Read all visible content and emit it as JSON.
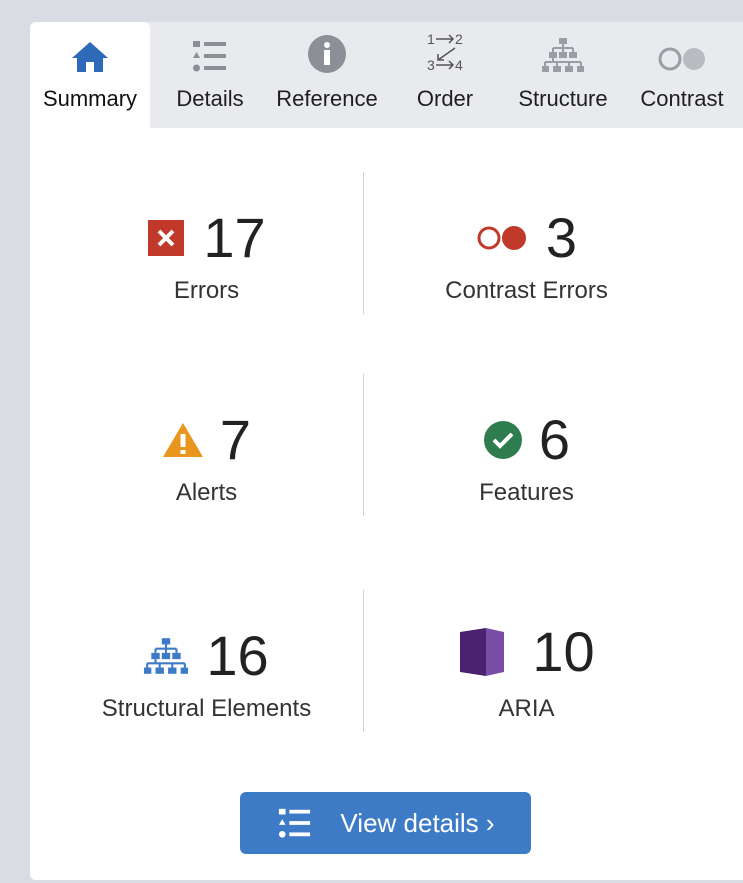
{
  "tabs": [
    {
      "label": "Summary",
      "icon": "home-icon",
      "active": true
    },
    {
      "label": "Details",
      "icon": "list-icon"
    },
    {
      "label": "Reference",
      "icon": "info-icon"
    },
    {
      "label": "Order",
      "icon": "order-icon",
      "icon_text": {
        "a": "1",
        "b": "2",
        "c": "3",
        "d": "4"
      }
    },
    {
      "label": "Structure",
      "icon": "structure-icon"
    },
    {
      "label": "Contrast",
      "icon": "contrast-icon"
    }
  ],
  "stats": {
    "errors": {
      "count": "17",
      "label": "Errors",
      "icon": "error-x-icon",
      "color": "#c0392b"
    },
    "contrast_errors": {
      "count": "3",
      "label": "Contrast Errors",
      "icon": "contrast-error-icon",
      "color": "#c0392b"
    },
    "alerts": {
      "count": "7",
      "label": "Alerts",
      "icon": "alert-triangle-icon",
      "color": "#e8961e"
    },
    "features": {
      "count": "6",
      "label": "Features",
      "icon": "feature-check-icon",
      "color": "#2e7d4f"
    },
    "structural": {
      "count": "16",
      "label": "Structural Elements",
      "icon": "structure-icon",
      "color": "#3d7bc6"
    },
    "aria": {
      "count": "10",
      "label": "ARIA",
      "icon": "aria-icon",
      "color": "#5b2a86"
    }
  },
  "button": {
    "label": "View details ›",
    "icon": "list-icon"
  }
}
